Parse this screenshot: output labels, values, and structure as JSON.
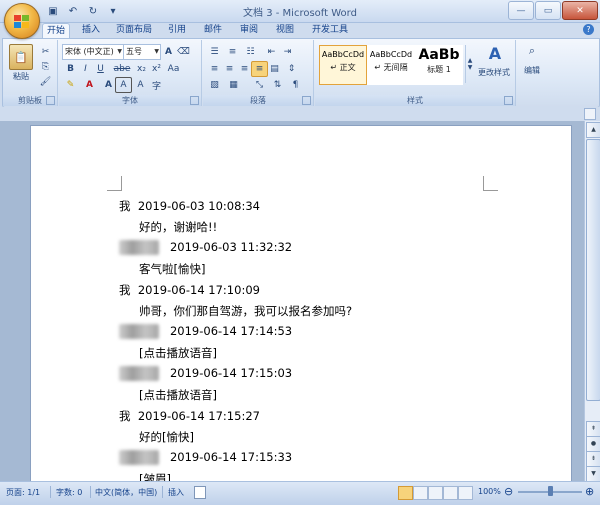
{
  "window": {
    "title": "文档 3 - Microsoft Word",
    "controls": {
      "minimize": "—",
      "maximize": "▭",
      "close": "✕"
    }
  },
  "qat": [
    {
      "name": "save-icon",
      "glyph": "💾"
    },
    {
      "name": "undo-icon",
      "glyph": "↶"
    },
    {
      "name": "redo-icon",
      "glyph": "↻"
    },
    {
      "name": "customize-icon",
      "glyph": "▾"
    }
  ],
  "tabs": [
    "开始",
    "插入",
    "页面布局",
    "引用",
    "邮件",
    "审阅",
    "视图",
    "开发工具"
  ],
  "active_tab": "开始",
  "ribbon": {
    "clipboard": {
      "label": "剪贴板",
      "paste": "粘贴"
    },
    "font": {
      "label": "字体",
      "font_name": "宋体 (中文正)",
      "font_size": "五号",
      "buttons": [
        "B",
        "I",
        "U",
        "abe",
        "x₂",
        "x²",
        "Aa",
        "A",
        "A",
        "A",
        "A",
        "字"
      ]
    },
    "paragraph": {
      "label": "段落"
    },
    "styles": {
      "label": "样式",
      "items": [
        {
          "sample": "AaBbCcDd",
          "name": "↵ 正文",
          "selected": true
        },
        {
          "sample": "AaBbCcDd",
          "name": "↵ 无间隔",
          "selected": false
        },
        {
          "sample": "AaBb",
          "name": "标题 1",
          "selected": false
        }
      ],
      "change_styles": "更改样式"
    },
    "editing": {
      "label": "编辑"
    }
  },
  "document": {
    "lines": [
      {
        "sender": "我",
        "sender_hidden": false,
        "time": "2019-06-03 10:08:34",
        "message": "好的，谢谢哈!!"
      },
      {
        "sender": "",
        "sender_hidden": true,
        "time": "2019-06-03 11:32:32",
        "message": "客气啦[愉快]"
      },
      {
        "sender": "我",
        "sender_hidden": false,
        "time": "2019-06-14 17:10:09",
        "message": "帅哥，你们那自驾游，我可以报名参加吗?"
      },
      {
        "sender": "",
        "sender_hidden": true,
        "time": "2019-06-14 17:14:53",
        "message": "[点击播放语音]"
      },
      {
        "sender": "",
        "sender_hidden": true,
        "time": "2019-06-14 17:15:03",
        "message": "[点击播放语音]"
      },
      {
        "sender": "我",
        "sender_hidden": false,
        "time": "2019-06-14 17:15:27",
        "message": "好的[愉快]"
      },
      {
        "sender": "",
        "sender_hidden": true,
        "time": "2019-06-14 17:15:33",
        "message": "[皱眉]"
      }
    ]
  },
  "status": {
    "page": "页面: 1/1",
    "words": "字数: 0",
    "language": "中文(简体，中国)",
    "mode": "插入",
    "zoom": "100%",
    "zoom_fraction": 0.5
  }
}
